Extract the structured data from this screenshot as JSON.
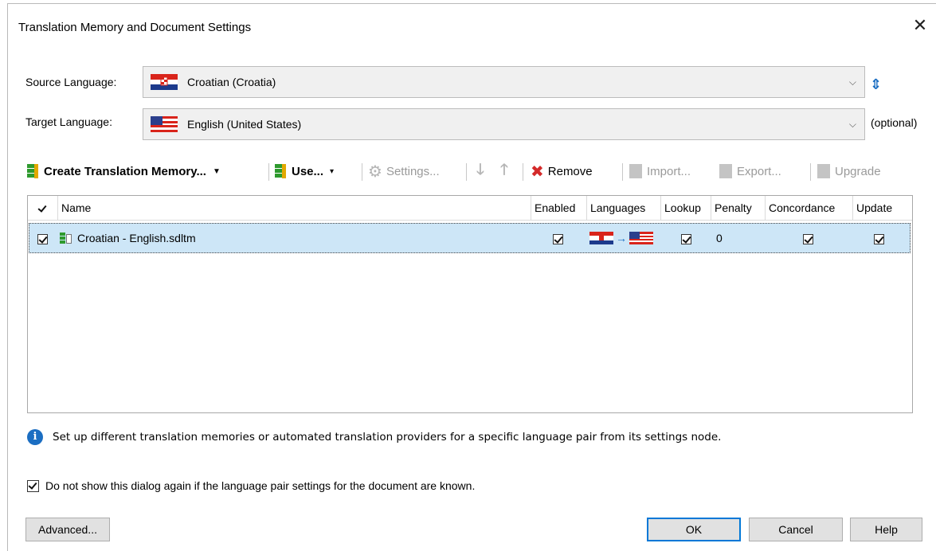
{
  "window": {
    "title": "Translation Memory and Document Settings"
  },
  "source": {
    "label": "Source Language:",
    "value": "Croatian (Croatia)"
  },
  "target": {
    "label": "Target Language:",
    "value": "English (United States)",
    "optional": "(optional)"
  },
  "toolbar": {
    "create": "Create Translation Memory...",
    "use": "Use...",
    "settings": "Settings...",
    "remove": "Remove",
    "import": "Import...",
    "export": "Export...",
    "upgrade": "Upgrade"
  },
  "grid": {
    "columns": [
      "Name",
      "Enabled",
      "Languages",
      "Lookup",
      "Penalty",
      "Concordance",
      "Update"
    ],
    "rows": [
      {
        "name": "Croatian - English.sdltm",
        "enabled": true,
        "lookup": true,
        "penalty": "0",
        "concordance": true,
        "update": true
      }
    ]
  },
  "info": {
    "text": "Set up different translation memories or automated translation providers for a specific language pair from its settings node."
  },
  "dont_show": {
    "label": "Do not show this dialog again if the language pair settings for the document are known.",
    "checked": true
  },
  "buttons": {
    "advanced": "Advanced...",
    "ok": "OK",
    "cancel": "Cancel",
    "help": "Help"
  },
  "colors": {
    "accent": "#0078d7",
    "selection": "#cde6f7",
    "remove_red": "#d42a2a"
  }
}
